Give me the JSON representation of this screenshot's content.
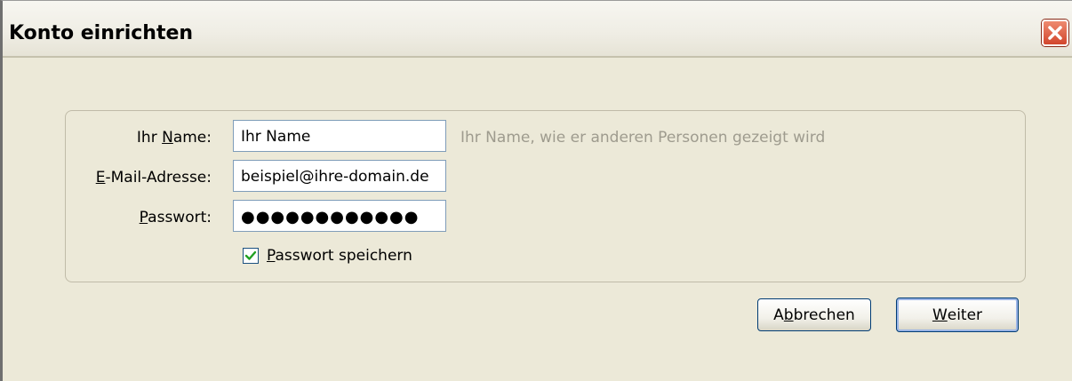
{
  "window": {
    "title": "Konto einrichten",
    "close_icon": "close-x-icon"
  },
  "form": {
    "name": {
      "label_pre": "Ihr ",
      "label_mnemonic": "N",
      "label_post": "ame:",
      "value": "Ihr Name",
      "hint": "Ihr Name, wie er anderen Personen gezeigt wird"
    },
    "email": {
      "label_pre": "",
      "label_mnemonic": "E",
      "label_post": "-Mail-Adresse:",
      "value": "beispiel@ihre-domain.de"
    },
    "password": {
      "label_pre": "",
      "label_mnemonic": "P",
      "label_post": "asswort:",
      "value": "●●●●●●●●●●●●"
    },
    "remember": {
      "checked": true,
      "label_mnemonic": "P",
      "label_post": "asswort speichern"
    }
  },
  "buttons": {
    "cancel": {
      "pre": "A",
      "mnemonic": "b",
      "post": "brechen"
    },
    "next": {
      "pre": "",
      "mnemonic": "W",
      "post": "eiter"
    }
  },
  "colors": {
    "dialog_bg": "#ece9d8",
    "close_red": "#d2462d",
    "hint_gray": "#9e9b8e",
    "check_green": "#21a121"
  }
}
